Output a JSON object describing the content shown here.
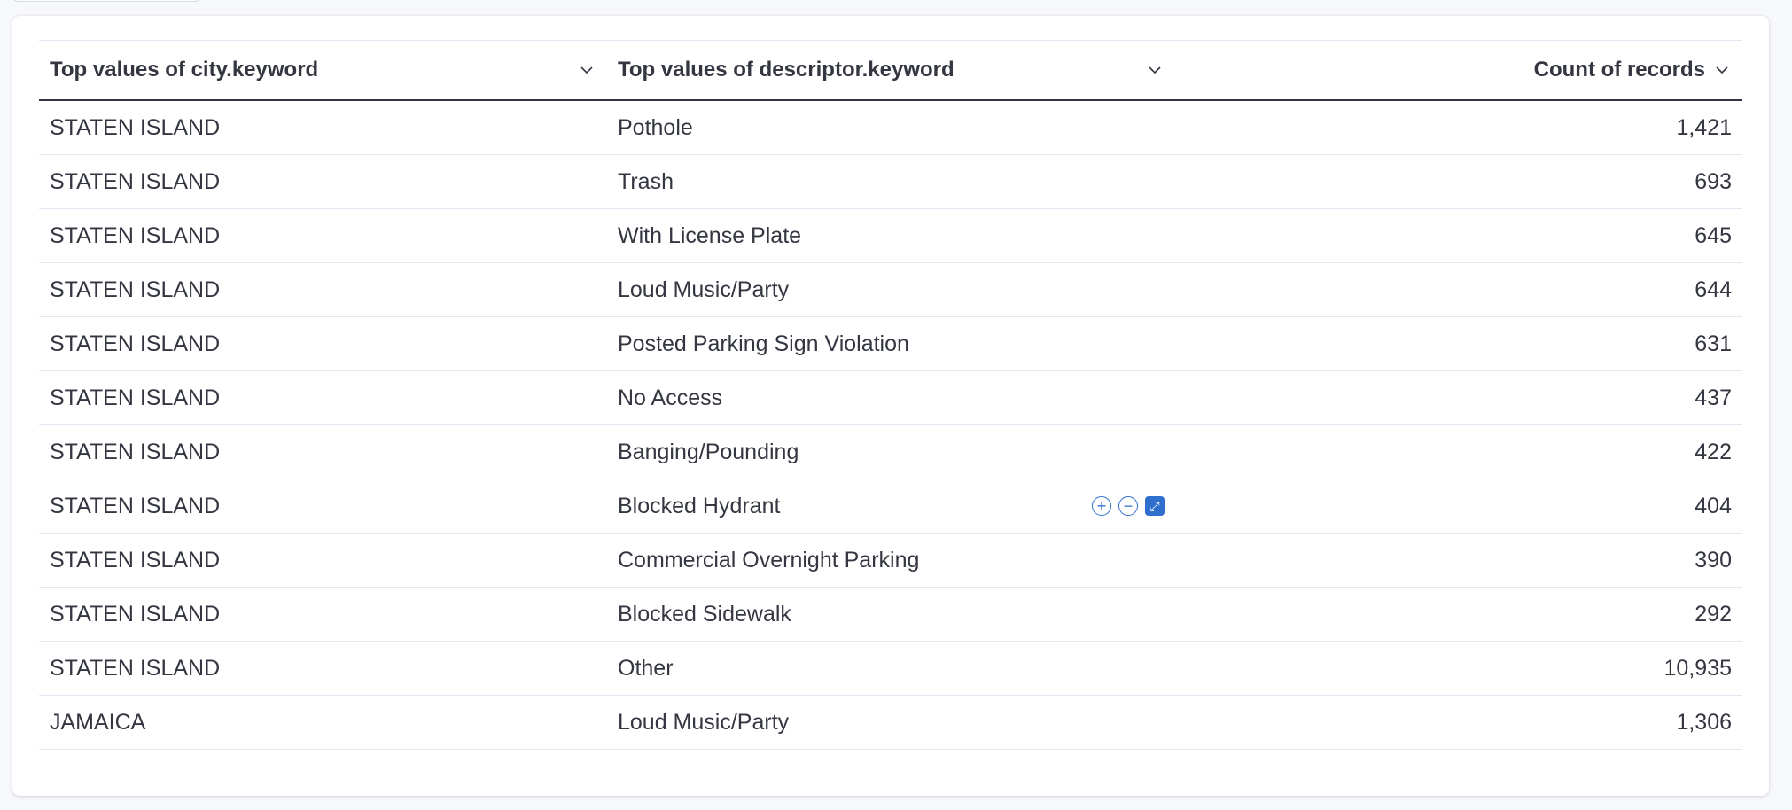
{
  "table": {
    "headers": [
      {
        "label": "Top values of city.keyword"
      },
      {
        "label": "Top values of descriptor.keyword"
      },
      {
        "label": "Count of records"
      }
    ],
    "rows": [
      {
        "city": "STATEN ISLAND",
        "descriptor": "Pothole",
        "count": "1,421"
      },
      {
        "city": "STATEN ISLAND",
        "descriptor": "Trash",
        "count": "693"
      },
      {
        "city": "STATEN ISLAND",
        "descriptor": "With License Plate",
        "count": "645"
      },
      {
        "city": "STATEN ISLAND",
        "descriptor": "Loud Music/Party",
        "count": "644"
      },
      {
        "city": "STATEN ISLAND",
        "descriptor": "Posted Parking Sign Violation",
        "count": "631"
      },
      {
        "city": "STATEN ISLAND",
        "descriptor": "No Access",
        "count": "437"
      },
      {
        "city": "STATEN ISLAND",
        "descriptor": "Banging/Pounding",
        "count": "422"
      },
      {
        "city": "STATEN ISLAND",
        "descriptor": "Blocked Hydrant",
        "count": "404"
      },
      {
        "city": "STATEN ISLAND",
        "descriptor": "Commercial Overnight Parking",
        "count": "390"
      },
      {
        "city": "STATEN ISLAND",
        "descriptor": "Blocked Sidewalk",
        "count": "292"
      },
      {
        "city": "STATEN ISLAND",
        "descriptor": "Other",
        "count": "10,935"
      },
      {
        "city": "JAMAICA",
        "descriptor": "Loud Music/Party",
        "count": "1,306"
      }
    ],
    "hovered_row_index": 7,
    "cell_action_icons": [
      "filter-for-icon",
      "filter-out-icon",
      "expand-icon"
    ]
  },
  "colors": {
    "accent": "#2f6fce",
    "text": "#343741",
    "border": "#e3e8f2"
  }
}
